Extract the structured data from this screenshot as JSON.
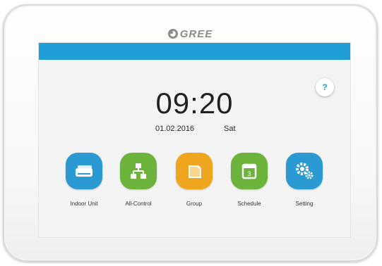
{
  "brand": "GREE",
  "help_label": "?",
  "clock": {
    "time": "09:20",
    "date": "01.02.2016",
    "weekday": "Sat"
  },
  "apps": [
    {
      "label": "Indoor Unit",
      "icon": "indoor-unit-icon",
      "color": "#2b9ad2"
    },
    {
      "label": "All-Control",
      "icon": "network-icon",
      "color": "#6bb33a"
    },
    {
      "label": "Group",
      "icon": "folder-icon",
      "color": "#f0a51f"
    },
    {
      "label": "Schedule",
      "icon": "calendar-icon",
      "color": "#6bb33a"
    },
    {
      "label": "Setting",
      "icon": "gear-icon",
      "color": "#2b9ad2"
    }
  ],
  "colors": {
    "topbar": "#1f9fd6",
    "screen_bg": "#f4f4f4"
  }
}
